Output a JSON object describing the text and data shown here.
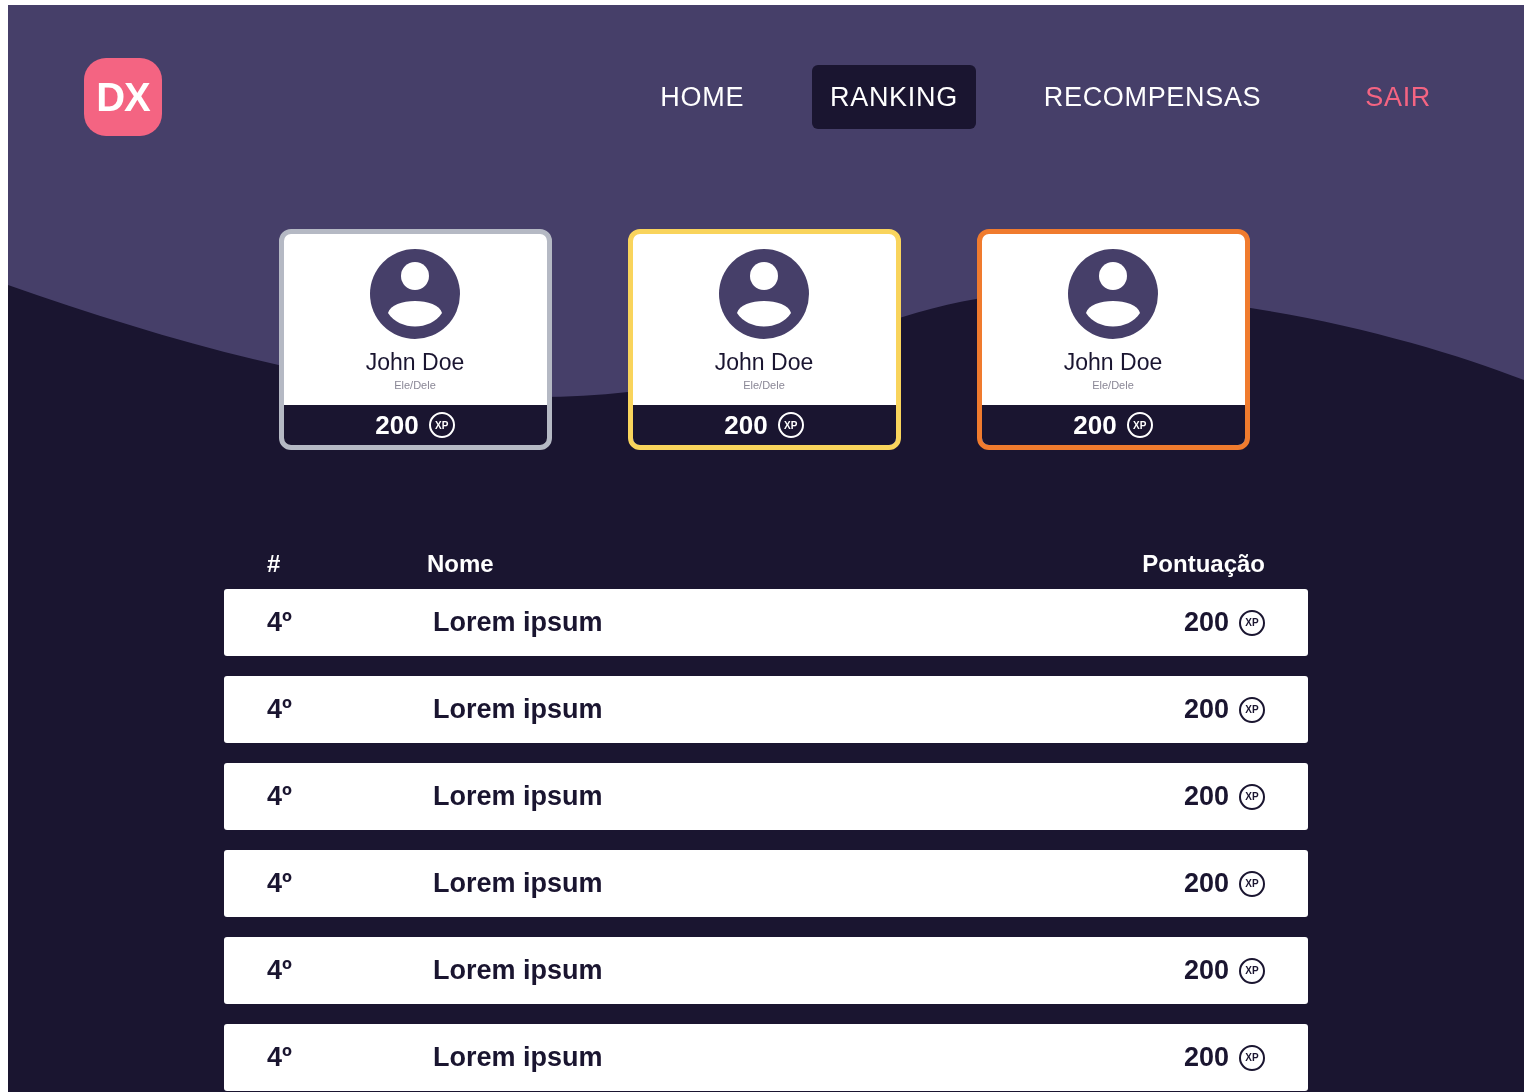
{
  "logo": {
    "text": "DX"
  },
  "nav": [
    {
      "label": "HOME",
      "kind": "link",
      "selected": false
    },
    {
      "label": "RANKING",
      "kind": "link",
      "selected": true
    },
    {
      "label": "RECOMPENSAS",
      "kind": "link",
      "selected": false
    },
    {
      "label": "SAIR",
      "kind": "logout",
      "selected": false
    }
  ],
  "podium": [
    {
      "name": "John Doe",
      "pronouns": "Ele/Dele",
      "score": "200",
      "badge": "XP",
      "color": "#b5b9c4"
    },
    {
      "name": "John Doe",
      "pronouns": "Ele/Dele",
      "score": "200",
      "badge": "XP",
      "color": "#f9d45c"
    },
    {
      "name": "John Doe",
      "pronouns": "Ele/Dele",
      "score": "200",
      "badge": "XP",
      "color": "#f07b2e"
    }
  ],
  "table": {
    "columns": [
      "#",
      "Nome",
      "Pontuação"
    ],
    "rows": [
      {
        "position": "4º",
        "name": "Lorem ipsum",
        "score": "200",
        "badge": "XP"
      },
      {
        "position": "4º",
        "name": "Lorem ipsum",
        "score": "200",
        "badge": "XP"
      },
      {
        "position": "4º",
        "name": "Lorem ipsum",
        "score": "200",
        "badge": "XP"
      },
      {
        "position": "4º",
        "name": "Lorem ipsum",
        "score": "200",
        "badge": "XP"
      },
      {
        "position": "4º",
        "name": "Lorem ipsum",
        "score": "200",
        "badge": "XP"
      },
      {
        "position": "4º",
        "name": "Lorem ipsum",
        "score": "200",
        "badge": "XP"
      }
    ]
  }
}
